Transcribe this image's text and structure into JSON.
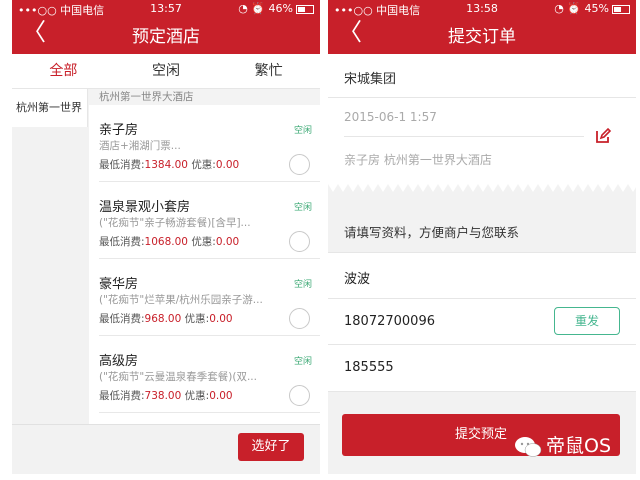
{
  "left": {
    "status": {
      "carrier": "•••○○ 中国电信",
      "time": "13:57",
      "battery": "46%",
      "battery_level": 0.46
    },
    "title": "预定酒店",
    "tabs": [
      "全部",
      "空闲",
      "繁忙"
    ],
    "sidebar": {
      "items": [
        "杭州第一世界"
      ]
    },
    "hotel_name": "杭州第一世界大酒店",
    "rooms": [
      {
        "name": "亲子房",
        "tag": "空闲",
        "desc": "酒店+湘湖门票...",
        "price_label": "最低消费:",
        "price": "1384.00",
        "discount_label": "优惠:",
        "discount": "0.00"
      },
      {
        "name": "温泉景观小套房",
        "tag": "空闲",
        "desc": "(\"花痴节\"亲子畅游套餐)[含早]...",
        "price_label": "最低消费:",
        "price": "1068.00",
        "discount_label": "优惠:",
        "discount": "0.00"
      },
      {
        "name": "豪华房",
        "tag": "空闲",
        "desc": "(\"花痴节\"烂苹果/杭州乐园亲子游...",
        "price_label": "最低消费:",
        "price": "968.00",
        "discount_label": "优惠:",
        "discount": "0.00"
      },
      {
        "name": "高级房",
        "tag": "空闲",
        "desc": "(\"花痴节\"云曼温泉春季套餐)(双...",
        "price_label": "最低消费:",
        "price": "738.00",
        "discount_label": "优惠:",
        "discount": "0.00"
      }
    ],
    "confirm_label": "选好了"
  },
  "right": {
    "status": {
      "carrier": "•••○○ 中国电信",
      "time": "13:58",
      "battery": "45%",
      "battery_level": 0.45
    },
    "title": "提交订单",
    "company": "宋城集团",
    "date": "2015-06-1 1:57",
    "room_info": "亲子房 杭州第一世界大酒店",
    "hint": "请填写资料，方便商户与您联系",
    "name_value": "波波",
    "phone_value": "18072700096",
    "resend_label": "重发",
    "code_value": "185555",
    "submit_label": "提交预定"
  },
  "watermark": {
    "text": "帝鼠OS"
  },
  "colors": {
    "brand_red": "#c8202a",
    "available_green": "#3aa873",
    "resend_green": "#45b68f"
  }
}
